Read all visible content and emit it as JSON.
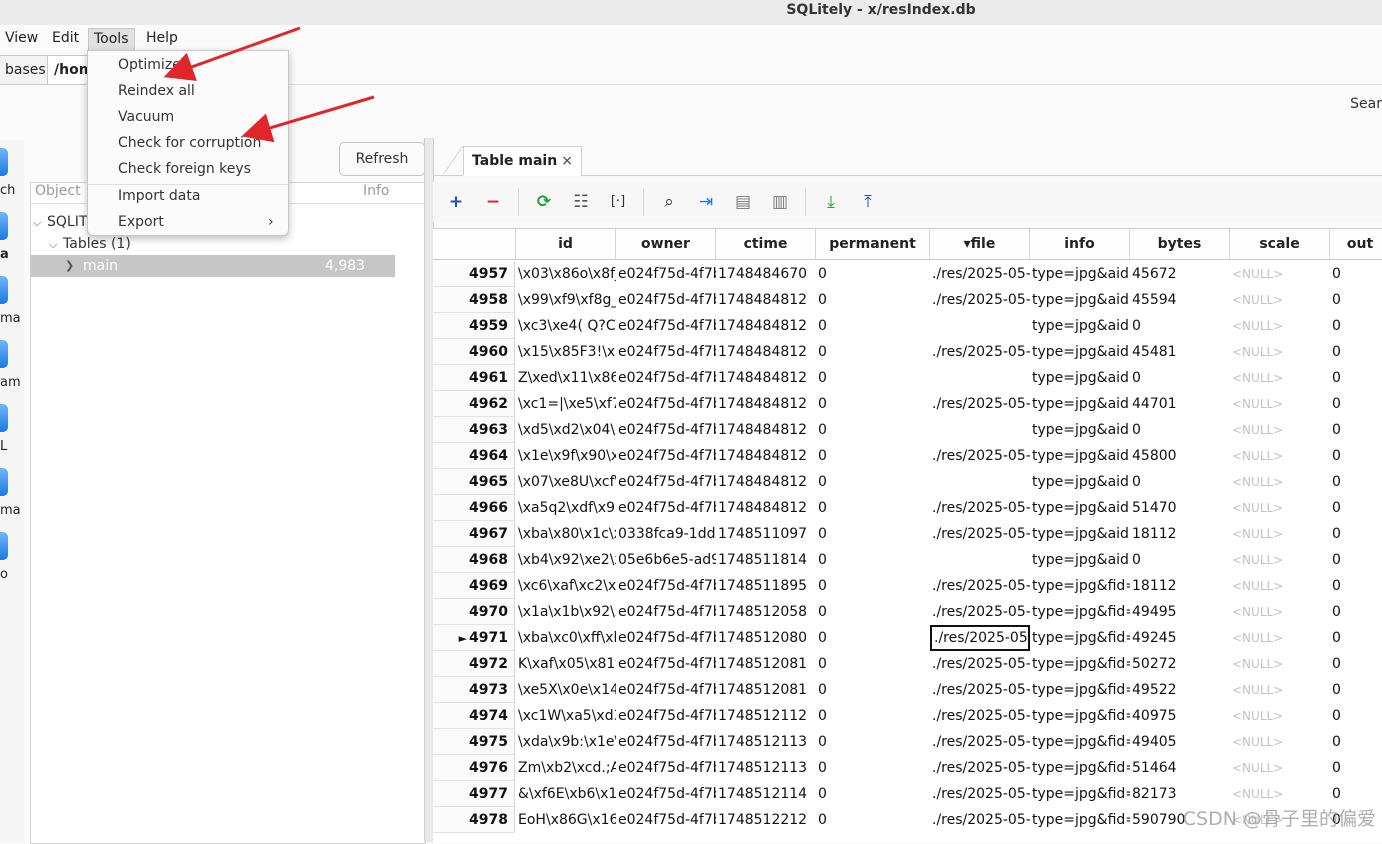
{
  "window": {
    "title": "SQLitely - x/resIndex.db"
  },
  "menubar": {
    "items": [
      "View",
      "Edit",
      "Tools",
      "Help"
    ]
  },
  "tools_menu": {
    "items": [
      "Optimize",
      "Reindex all",
      "Vacuum",
      "Check for corruption",
      "Check foreign keys",
      "Import data",
      "Export"
    ],
    "submenu_arrow": "›"
  },
  "tabs_strip": {
    "databases_tab": "bases",
    "current_db_tab": "/hom"
  },
  "search": {
    "label": "Sear"
  },
  "rail": {
    "labels": [
      "ch",
      "a",
      "ma",
      "am",
      "L",
      "ma",
      "o"
    ]
  },
  "object_panel": {
    "refresh_label": "Refresh",
    "col_object": "Object",
    "col_info": "Info",
    "root": "SQLIT",
    "tables_label": "Tables (1)",
    "table_name": "main",
    "table_rows": "4,983 rows"
  },
  "table_tab": {
    "label": "Table main",
    "close": "×"
  },
  "toolbar": {
    "add": "+",
    "remove": "−",
    "refresh": "⟳",
    "filter": "☷",
    "brackets": "[·]",
    "search": "⌕",
    "goto": "⇥",
    "form1": "▤",
    "form2": "▥",
    "export": "⤓",
    "import": "⤒"
  },
  "grid": {
    "columns": [
      "id",
      "owner",
      "ctime",
      "permanent",
      "▾file",
      "info",
      "bytes",
      "scale",
      "out"
    ],
    "rows": [
      {
        "n": "4957",
        "id": "\\x03\\x86o\\x8fj'",
        "owner": "e024f75d-4f7b",
        "ctime": "1748484670",
        "perm": "0",
        "file": "./res/2025-05-2",
        "info": "type=jpg&aid=",
        "bytes": "45672",
        "scale": "<NULL>",
        "out": "0"
      },
      {
        "n": "4958",
        "id": "\\x99\\xf9\\xf8g_",
        "owner": "e024f75d-4f7b",
        "ctime": "1748484812",
        "perm": "0",
        "file": "./res/2025-05-2",
        "info": "type=jpg&aid=",
        "bytes": "45594",
        "scale": "<NULL>",
        "out": "0"
      },
      {
        "n": "4959",
        "id": "\\xc3\\xe4( Q?C\\;",
        "owner": "e024f75d-4f7b",
        "ctime": "1748484812",
        "perm": "0",
        "file": "",
        "info": "type=jpg&aid=",
        "bytes": "0",
        "scale": "<NULL>",
        "out": "0"
      },
      {
        "n": "4960",
        "id": "\\x15\\x85F3!\\xb",
        "owner": "e024f75d-4f7b",
        "ctime": "1748484812",
        "perm": "0",
        "file": "./res/2025-05-2",
        "info": "type=jpg&aid=",
        "bytes": "45481",
        "scale": "<NULL>",
        "out": "0"
      },
      {
        "n": "4961",
        "id": "Z\\xed\\x11\\x86\\",
        "owner": "e024f75d-4f7b",
        "ctime": "1748484812",
        "perm": "0",
        "file": "",
        "info": "type=jpg&aid=",
        "bytes": "0",
        "scale": "<NULL>",
        "out": "0"
      },
      {
        "n": "4962",
        "id": "\\xc1=|\\xe5\\xf7'",
        "owner": "e024f75d-4f7b",
        "ctime": "1748484812",
        "perm": "0",
        "file": "./res/2025-05-2",
        "info": "type=jpg&aid=",
        "bytes": "44701",
        "scale": "<NULL>",
        "out": "0"
      },
      {
        "n": "4963",
        "id": "\\xd5\\xd2\\x04\\x",
        "owner": "e024f75d-4f7b",
        "ctime": "1748484812",
        "perm": "0",
        "file": "",
        "info": "type=jpg&aid=",
        "bytes": "0",
        "scale": "<NULL>",
        "out": "0"
      },
      {
        "n": "4964",
        "id": "\\x1e\\x9f\\x90\\x",
        "owner": "e024f75d-4f7b",
        "ctime": "1748484812",
        "perm": "0",
        "file": "./res/2025-05-2",
        "info": "type=jpg&aid=",
        "bytes": "45800",
        "scale": "<NULL>",
        "out": "0"
      },
      {
        "n": "4965",
        "id": "\\x07\\xe8U\\xcf\\",
        "owner": "e024f75d-4f7b",
        "ctime": "1748484812",
        "perm": "0",
        "file": "",
        "info": "type=jpg&aid=",
        "bytes": "0",
        "scale": "<NULL>",
        "out": "0"
      },
      {
        "n": "4966",
        "id": "\\xa5q2\\xdf\\x92",
        "owner": "e024f75d-4f7b",
        "ctime": "1748484812",
        "perm": "0",
        "file": "./res/2025-05-2",
        "info": "type=jpg&aid=",
        "bytes": "51470",
        "scale": "<NULL>",
        "out": "0"
      },
      {
        "n": "4967",
        "id": "\\xba\\x80\\x1c\\x",
        "owner": "0338fca9-1dd5",
        "ctime": "1748511097",
        "perm": "0",
        "file": "./res/2025-05-2",
        "info": "type=jpg&aid=",
        "bytes": "18112",
        "scale": "<NULL>",
        "out": "0"
      },
      {
        "n": "4968",
        "id": "\\xb4\\x92\\xe2\\x",
        "owner": "05e6b6e5-ad9l",
        "ctime": "1748511814",
        "perm": "0",
        "file": "",
        "info": "type=jpg&aid=",
        "bytes": "0",
        "scale": "<NULL>",
        "out": "0"
      },
      {
        "n": "4969",
        "id": "\\xc6\\xaf\\xc2\\xe",
        "owner": "e024f75d-4f7b",
        "ctime": "1748511895",
        "perm": "0",
        "file": "./res/2025-05-2",
        "info": "type=jpg&fid=",
        "bytes": "18112",
        "scale": "<NULL>",
        "out": "0"
      },
      {
        "n": "4970",
        "id": "\\x1a\\x1b\\x92\\x",
        "owner": "e024f75d-4f7b",
        "ctime": "1748512058",
        "perm": "0",
        "file": "./res/2025-05-2",
        "info": "type=jpg&fid=",
        "bytes": "49495",
        "scale": "<NULL>",
        "out": "0"
      },
      {
        "n": "4971",
        "id": "\\xba\\xc0\\xff\\xb",
        "owner": "e024f75d-4f7b",
        "ctime": "1748512080",
        "perm": "0",
        "file": "./res/2025-05-2",
        "info": "type=jpg&fid=",
        "bytes": "49245",
        "scale": "<NULL>",
        "out": "0",
        "current": true
      },
      {
        "n": "4972",
        "id": "K\\xaf\\x05\\x81f",
        "owner": "e024f75d-4f7b",
        "ctime": "1748512081",
        "perm": "0",
        "file": "./res/2025-05-2",
        "info": "type=jpg&fid=",
        "bytes": "50272",
        "scale": "<NULL>",
        "out": "0"
      },
      {
        "n": "4973",
        "id": "\\xe5X\\x0e\\x14\\",
        "owner": "e024f75d-4f7b",
        "ctime": "1748512081",
        "perm": "0",
        "file": "./res/2025-05-2",
        "info": "type=jpg&fid=",
        "bytes": "49522",
        "scale": "<NULL>",
        "out": "0"
      },
      {
        "n": "4974",
        "id": "\\xc1W\\xa5\\xd3",
        "owner": "e024f75d-4f7b",
        "ctime": "1748512112",
        "perm": "0",
        "file": "./res/2025-05-2",
        "info": "type=jpg&fid=",
        "bytes": "40975",
        "scale": "<NULL>",
        "out": "0"
      },
      {
        "n": "4975",
        "id": "\\xda\\x9b:\\x1e\\",
        "owner": "e024f75d-4f7b",
        "ctime": "1748512113",
        "perm": "0",
        "file": "./res/2025-05-2",
        "info": "type=jpg&fid=",
        "bytes": "49405",
        "scale": "<NULL>",
        "out": "0"
      },
      {
        "n": "4976",
        "id": "Zm\\xb2\\xcd.;A",
        "owner": "e024f75d-4f7b",
        "ctime": "1748512113",
        "perm": "0",
        "file": "./res/2025-05-2",
        "info": "type=jpg&fid=",
        "bytes": "51464",
        "scale": "<NULL>",
        "out": "0"
      },
      {
        "n": "4977",
        "id": "&\\xf6E\\xb6\\x1l",
        "owner": "e024f75d-4f7b",
        "ctime": "1748512114",
        "perm": "0",
        "file": "./res/2025-05-2",
        "info": "type=jpg&fid=",
        "bytes": "82173",
        "scale": "<NULL>",
        "out": "0"
      },
      {
        "n": "4978",
        "id": "EoH\\x86G\\x16.",
        "owner": "e024f75d-4f7b",
        "ctime": "1748512212",
        "perm": "0",
        "file": "./res/2025-05-2",
        "info": "type=jpg&fid=",
        "bytes": "590790",
        "scale": "<NULL>",
        "out": "0"
      }
    ],
    "current_marker": "►"
  },
  "watermark": {
    "text": "CSDN @骨子里的偏爱"
  },
  "colors": {
    "arrow": "#e0262a",
    "accent_blue": "#1f78e0",
    "null_text": "#c3c3c3"
  }
}
